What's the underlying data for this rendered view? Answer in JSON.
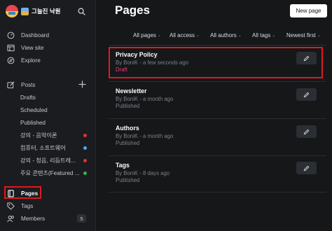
{
  "sidebar": {
    "brand": "그늘진 낙원",
    "nav": [
      {
        "label": "Dashboard",
        "icon": "dashboard-icon"
      },
      {
        "label": "View site",
        "icon": "view-site-icon"
      },
      {
        "label": "Explore",
        "icon": "explore-icon"
      }
    ],
    "posts": {
      "label": "Posts",
      "sub_items": [
        {
          "label": "Drafts",
          "dot": ""
        },
        {
          "label": "Scheduled",
          "dot": ""
        },
        {
          "label": "Published",
          "dot": ""
        },
        {
          "label": "강의 - 음악이론",
          "dot": "#e03131"
        },
        {
          "label": "컴퓨터, 소프트웨어",
          "dot": "#4dabf7"
        },
        {
          "label": "강의 - 청음, 리듬트레...",
          "dot": "#e03131"
        },
        {
          "label": "주요 콘텐츠(Featured ...",
          "dot": "#37b24d"
        }
      ]
    },
    "pages": {
      "label": "Pages"
    },
    "tags": {
      "label": "Tags"
    },
    "members": {
      "label": "Members",
      "count": "5"
    }
  },
  "main": {
    "title": "Pages",
    "new_page_label": "New page",
    "filters": [
      "All pages",
      "All access",
      "All authors",
      "All tags",
      "Newest first"
    ],
    "pages": [
      {
        "title": "Privacy Policy",
        "meta": "By BoniK - a few seconds ago",
        "status": "Draft",
        "is_draft": true
      },
      {
        "title": "Newsletter",
        "meta": "By BoniK - a month ago",
        "status": "Published",
        "is_draft": false
      },
      {
        "title": "Authors",
        "meta": "By BoniK - a month ago",
        "status": "Published",
        "is_draft": false
      },
      {
        "title": "Tags",
        "meta": "By BoniK - 8 days ago",
        "status": "Published",
        "is_draft": false
      }
    ]
  },
  "colors": {
    "highlight": "#e0191d",
    "draft": "#f2367f",
    "background": "#151719"
  }
}
